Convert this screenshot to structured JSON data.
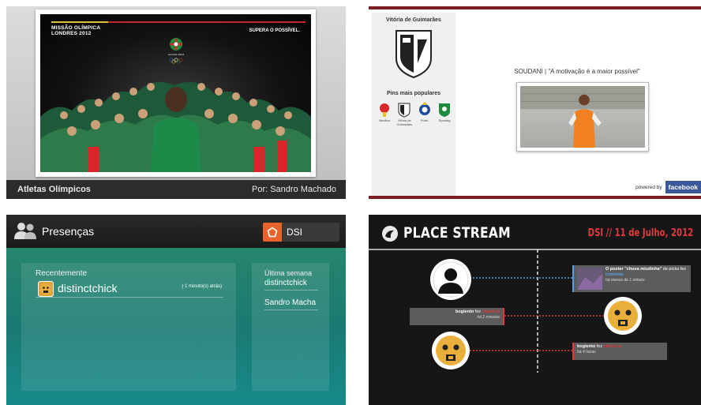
{
  "panel_athletes": {
    "poster_title_line1": "MISSÃO OLÍMPICA",
    "poster_title_line2": "LONDRES 2012",
    "poster_slogan": "SUPERA O POSSÍVEL.",
    "emblem_caption": "Londres 2012",
    "caption_left": "Atletas Olímpicos",
    "caption_right": "Por: Sandro Machado"
  },
  "panel_facebook": {
    "club_name": "Vitória de Guimarães",
    "pins_title": "Pins mais populares",
    "pins": [
      {
        "label": "Benfica",
        "color": "#d8262b"
      },
      {
        "label": "Vitória de Guimarães",
        "color": "#222222"
      },
      {
        "label": "Porto",
        "color": "#1d4c9c"
      },
      {
        "label": "Sporting",
        "color": "#1e8a3c"
      }
    ],
    "quote": "SOUDANI | \"A motivação é a maior possível\"",
    "powered_by": "powered by",
    "brand": "facebook",
    "brand_color": "#3b5998"
  },
  "panel_presencas": {
    "title": "Presenças",
    "badge_label": "DSI",
    "recent_label": "Recentemente",
    "recent_user": "distinctchick",
    "recent_time": "( 1 minuto(s) atrás)",
    "week_label": "Última semana",
    "week_users": [
      "distinctchick",
      "Sandro Macha"
    ]
  },
  "panel_stream": {
    "title": "PLACE STREAM",
    "date": "DSI // 11 de Julho, 2012",
    "events": [
      {
        "user": "O poster",
        "quoted": "\"chuva miudinha\"",
        "verb": "de picka fez",
        "action": "comenta",
        "time": "há menos de 1 minuto"
      },
      {
        "user": "bogiento",
        "verb": "fez",
        "action": "check-in",
        "time": "há 2 minutos"
      },
      {
        "user": "bogiento",
        "verb": "fez",
        "action": "check-in",
        "time": "há 4 horas"
      }
    ],
    "accent_color": "#e23a3a",
    "line_blue": "#5ba0e0"
  }
}
